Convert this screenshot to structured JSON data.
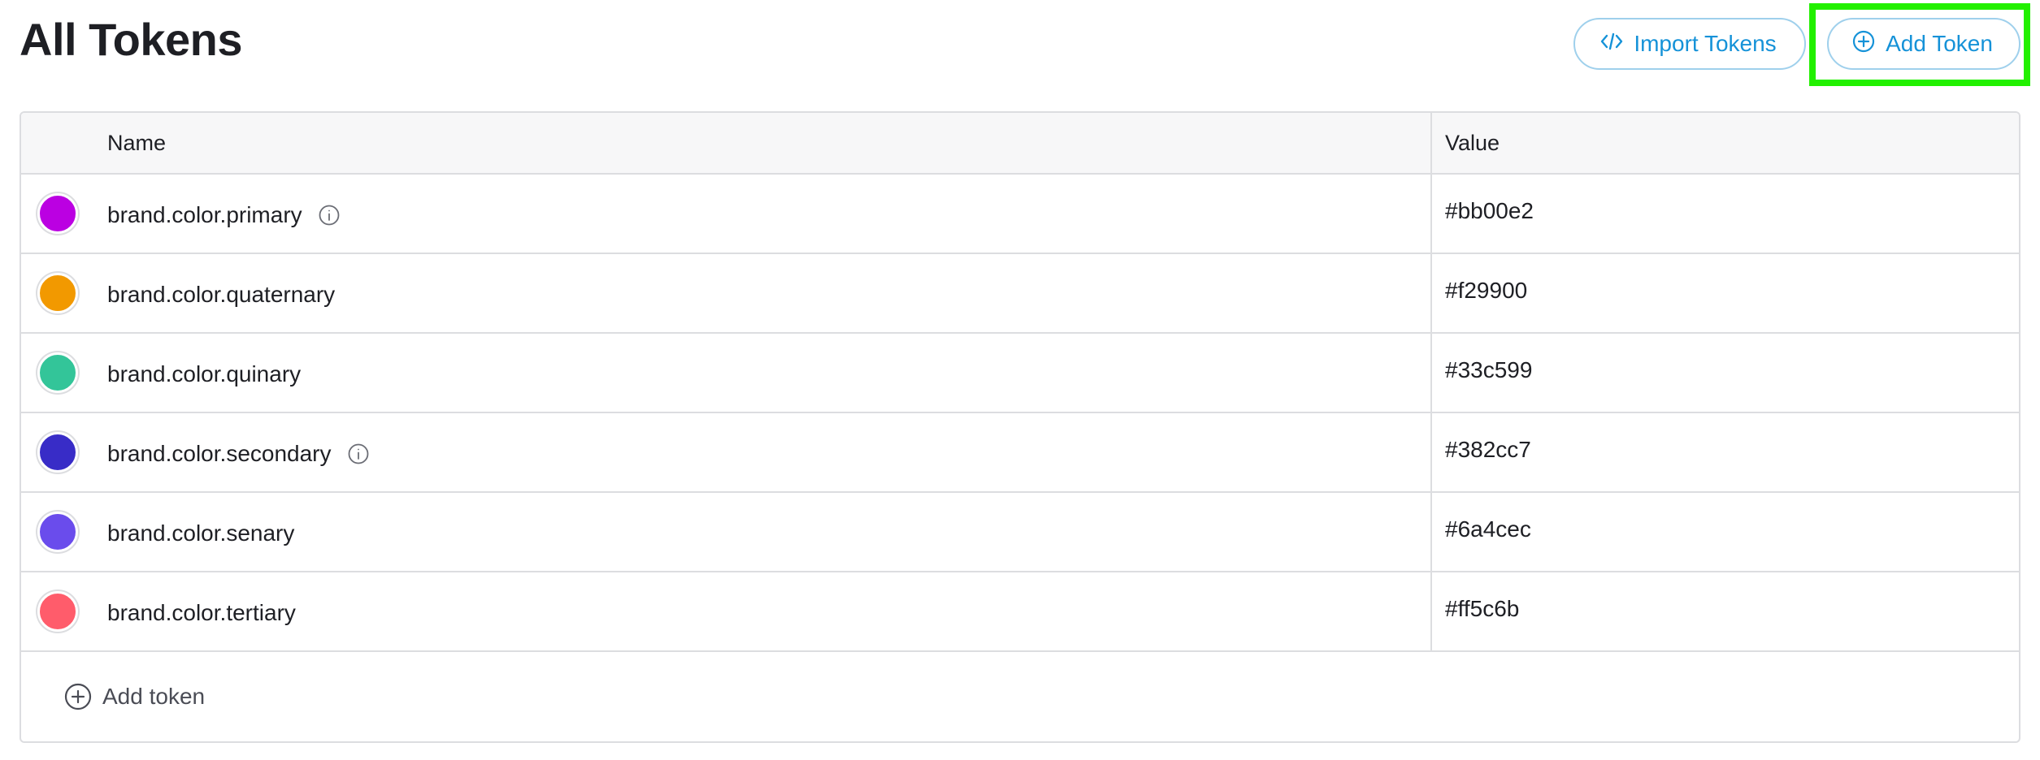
{
  "header": {
    "title": "All Tokens",
    "import_label": "Import Tokens",
    "add_label": "Add Token"
  },
  "table": {
    "columns": {
      "name": "Name",
      "value": "Value"
    },
    "rows": [
      {
        "name": "brand.color.primary",
        "value": "#bb00e2",
        "color": "#bb00e2",
        "info": true
      },
      {
        "name": "brand.color.quaternary",
        "value": "#f29900",
        "color": "#f29900",
        "info": false
      },
      {
        "name": "brand.color.quinary",
        "value": "#33c599",
        "color": "#33c599",
        "info": false
      },
      {
        "name": "brand.color.secondary",
        "value": "#382cc7",
        "color": "#382cc7",
        "info": true
      },
      {
        "name": "brand.color.senary",
        "value": "#6a4cec",
        "color": "#6a4cec",
        "info": false
      },
      {
        "name": "brand.color.tertiary",
        "value": "#ff5c6b",
        "color": "#ff5c6b",
        "info": false
      }
    ],
    "add_row_label": "Add token"
  },
  "icons": {
    "import": "code-icon",
    "add": "plus-circle-icon",
    "info": "info-icon"
  },
  "colors": {
    "accent": "#1592d8",
    "highlight": "#22f000"
  }
}
